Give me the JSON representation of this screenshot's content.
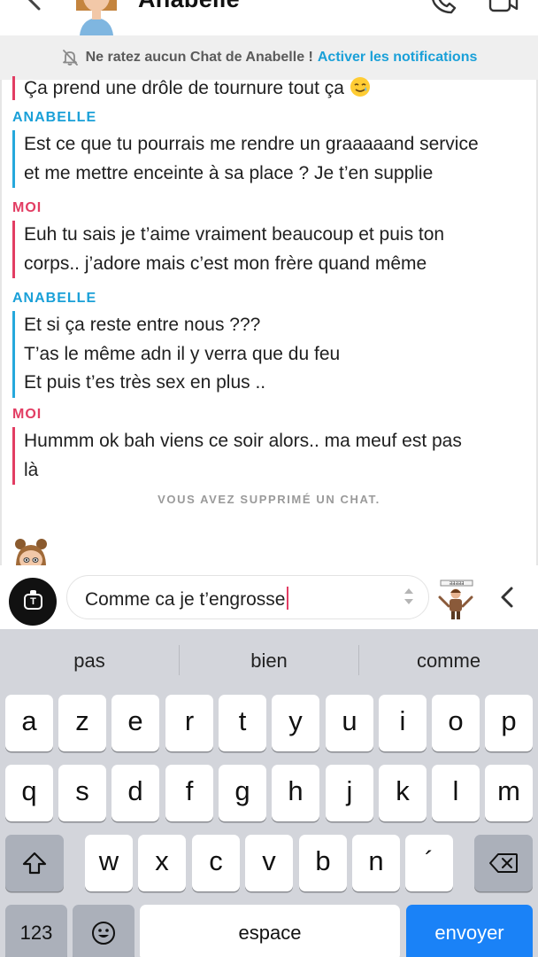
{
  "header": {
    "contact_name": "Anabelle"
  },
  "notification": {
    "text": "Ne ratez aucun Chat de Anabelle !",
    "link": "Activer les notifications"
  },
  "chat": {
    "top_partial_message": "Ça prend une drôle de tournure tout ça",
    "messages": [
      {
        "sender": "ANABELLE",
        "lines": [
          "Est ce que tu pourrais me rendre un graaaaand service",
          "et me mettre enceinte à sa place ? Je t’en supplie"
        ]
      },
      {
        "sender": "MOI",
        "lines": [
          "Euh tu sais je t’aime vraiment beaucoup et puis ton",
          "corps.. j’adore mais c’est mon frère quand même"
        ]
      },
      {
        "sender": "ANABELLE",
        "lines": [
          "Et si ça reste entre nous ???",
          "T’as le même adn il y verra que du feu",
          "Et puis t’es très sex en plus .."
        ]
      },
      {
        "sender": "MOI",
        "lines": [
          "Hummm ok bah viens ce soir alors.. ma meuf est pas",
          "là"
        ]
      }
    ],
    "system_note": "VOUS AVEZ SUPPRIMÉ UN CHAT."
  },
  "composer": {
    "camera_label": "T",
    "value": "Comme ca je t’engrosse"
  },
  "keyboard": {
    "suggestions": [
      "pas",
      "bien",
      "comme"
    ],
    "row1": [
      "a",
      "z",
      "e",
      "r",
      "t",
      "y",
      "u",
      "i",
      "o",
      "p"
    ],
    "row2": [
      "q",
      "s",
      "d",
      "f",
      "g",
      "h",
      "j",
      "k",
      "l",
      "m"
    ],
    "row3": [
      "w",
      "x",
      "c",
      "v",
      "b",
      "n",
      "´"
    ],
    "numbers_key": "123",
    "space_key": "espace",
    "send_key": "envoyer"
  },
  "colors": {
    "her_accent": "#26a8dc",
    "me_accent": "#e23d63",
    "send_key": "#1a82f7"
  }
}
